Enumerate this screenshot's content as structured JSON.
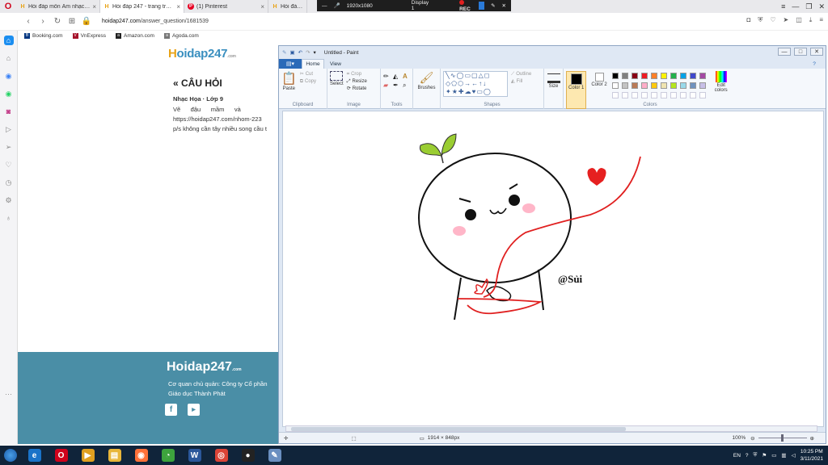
{
  "browser": {
    "tabs": [
      {
        "icon": "H",
        "label": "Hỏi đáp môn Âm nhạc, Mĩ",
        "active": false
      },
      {
        "icon": "H",
        "label": "Hỏi đáp 247 - trang trả lời",
        "active": true
      },
      {
        "icon": "P",
        "label": "(1) Pinterest",
        "active": false
      },
      {
        "icon": "H",
        "label": "Hỏi đáp 24",
        "active": false
      }
    ],
    "recorder": {
      "resolution": "1920x1080",
      "display": "Display 1",
      "rec": "REC"
    },
    "url_host": "hoidap247.com",
    "url_path": "/answer_question/1681539",
    "bookmarks": [
      {
        "icon": "B",
        "label": "Booking.com",
        "color": "#003580"
      },
      {
        "icon": "V",
        "label": "VnExpress",
        "color": "#a5122a"
      },
      {
        "icon": "a",
        "label": "Amazon.com",
        "color": "#222222"
      },
      {
        "icon": "a",
        "label": "Agoda.com",
        "color": "#777777"
      }
    ]
  },
  "page": {
    "logo_ho": "H",
    "logo_rest": "oidap247",
    "logo_sub": ".com",
    "question_title": "« CÂU HỎI",
    "meta": "Nhạc Họa · Lớp 9",
    "body_line1": "Vẽ      đậu      mầm      và",
    "body_line2": "https://hoidap247.com/nhom-223",
    "body_line3": "p/s không cần tây nhiều song cầu t",
    "footer_logo": "Hoidap247",
    "footer_sub": ".com",
    "footer_line1": "Cơ quan chủ quản: Công ty Cổ phần",
    "footer_line2": "Giáo dục Thành Phát"
  },
  "paint": {
    "title": "Untitled - Paint",
    "tabs": [
      "Home",
      "View"
    ],
    "groups": {
      "clipboard": "Clipboard",
      "image": "Image",
      "tools": "Tools",
      "shapes": "Shapes",
      "colors": "Colors"
    },
    "buttons": {
      "paste": "Paste",
      "cut": "Cut",
      "copy": "Copy",
      "select": "Select",
      "crop": "Crop",
      "resize": "Resize",
      "rotate": "Rotate",
      "brushes": "Brushes",
      "outline": "Outline",
      "fill": "Fill",
      "size": "Size",
      "color1": "Color 1",
      "color2": "Color 2",
      "edit_colors": "Edit colors"
    },
    "palette": [
      "#000000",
      "#7f7f7f",
      "#880015",
      "#ed1c24",
      "#ff7f27",
      "#fff200",
      "#22b14c",
      "#00a2e8",
      "#3f48cc",
      "#a349a4",
      "#ffffff",
      "#c3c3c3",
      "#b97a57",
      "#ffaec9",
      "#ffc90e",
      "#efe4b0",
      "#b5e61d",
      "#99d9ea",
      "#7092be",
      "#c8bfe7"
    ],
    "color1": "#000000",
    "color2": "#ffffff",
    "signature": "@Sủi",
    "dimensions": "1914 × 848px",
    "zoom": "100%"
  },
  "taskbar": {
    "apps": [
      {
        "name": "explorer-icon",
        "glyph": "e",
        "color": "#1a73c8"
      },
      {
        "name": "opera-icon",
        "glyph": "O",
        "color": "#d0021b"
      },
      {
        "name": "media-icon",
        "glyph": "▶",
        "color": "#e0a020"
      },
      {
        "name": "folder-icon",
        "glyph": "▤",
        "color": "#e8b63a"
      },
      {
        "name": "firefox-icon",
        "glyph": "◉",
        "color": "#ff7139"
      },
      {
        "name": "greenshot-icon",
        "glyph": "◔",
        "color": "#3da33d"
      },
      {
        "name": "word-icon",
        "glyph": "W",
        "color": "#2b579a"
      },
      {
        "name": "chrome-icon",
        "glyph": "◎",
        "color": "#db4437"
      },
      {
        "name": "record-icon",
        "glyph": "●",
        "color": "#222222"
      },
      {
        "name": "paint-icon",
        "glyph": "✎",
        "color": "#6a8fc0"
      }
    ],
    "lang": "EN",
    "time": "10:25 PM",
    "date": "3/11/2021"
  }
}
